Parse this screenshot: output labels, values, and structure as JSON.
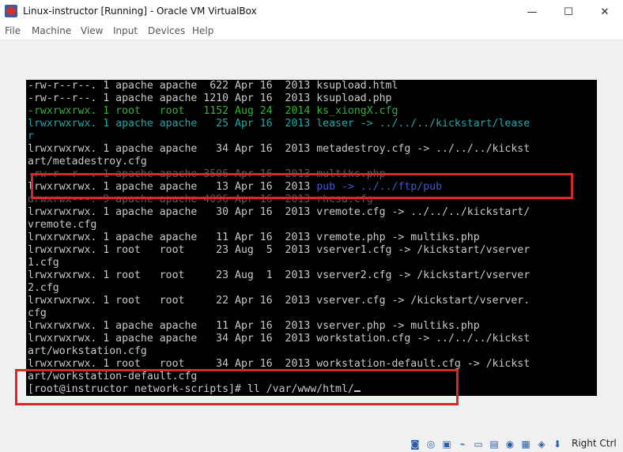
{
  "window": {
    "title": "Linux-instructor [Running] - Oracle VM VirtualBox",
    "minimize": "—",
    "maximize": "☐",
    "close": "✕"
  },
  "menu": [
    "File",
    "Machine",
    "View",
    "Input",
    "Devices",
    "Help"
  ],
  "terminal": {
    "lines": [
      "-rw-r--r--. 1 apache apache  622 Apr 16  2013 ksupload.html",
      "-rw-r--r--. 1 apache apache 1210 Apr 16  2013 ksupload.php",
      "-rwxrwxrwx. 1 root   root   1152 Aug 24  2014 ks_xiongX.cfg",
      "lrwxrwxrwx. 1 apache apache   25 Apr 16  2013 leaser -> ../../../kickstart/lease",
      "r",
      "lrwxrwxrwx. 1 apache apache   34 Apr 16  2013 metadestroy.cfg -> ../../../kickst",
      "art/metadestroy.cfg",
      "-rw-r--r--. 1 apache apache 3506 Apr 16  2013 multiks.php",
      "lrwxrwxrwx. 1 apache apache   13 Apr 16  2013 pub -> ../../ftp/pub",
      "drwxrwx---. 9 apache apache 4096 Apr 16  2013 rhcsa.cfg",
      "lrwxrwxrwx. 1 apache apache   30 Apr 16  2013 vremote.cfg -> ../../../kickstart/",
      "vremote.cfg",
      "lrwxrwxrwx. 1 apache apache   11 Apr 16  2013 vremote.php -> multiks.php",
      "lrwxrwxrwx. 1 root   root     23 Aug  5  2013 vserver1.cfg -> /kickstart/vserver",
      "1.cfg",
      "lrwxrwxrwx. 1 root   root     23 Aug  1  2013 vserver2.cfg -> /kickstart/vserver",
      "2.cfg",
      "lrwxrwxrwx. 1 root   root     22 Apr 16  2013 vserver.cfg -> /kickstart/vserver.",
      "cfg",
      "lrwxrwxrwx. 1 apache apache   11 Apr 16  2013 vserver.php -> multiks.php",
      "lrwxrwxrwx. 1 apache apache   34 Apr 16  2013 workstation.cfg -> ../../../kickst",
      "art/workstation.cfg",
      "lrwxrwxrwx. 1 root   root     34 Apr 16  2013 workstation-default.cfg -> /kickst",
      "art/workstation-default.cfg"
    ],
    "prompt": "[root@instructor network-scripts]# ll /var/www/html/"
  },
  "colors": {
    "link": "#1fa7a7",
    "pub_link": "#3b58d8",
    "executable": "#34b234",
    "highlight_box": "#d82727"
  },
  "statusbar": {
    "icons": [
      "hard-disk-icon",
      "optical-drive-icon",
      "network-icon",
      "usb-icon",
      "shared-folders-icon",
      "display-icon",
      "video-capture-icon",
      "cpu-icon",
      "host-key-arrow-icon"
    ],
    "host_key": "Right Ctrl"
  }
}
